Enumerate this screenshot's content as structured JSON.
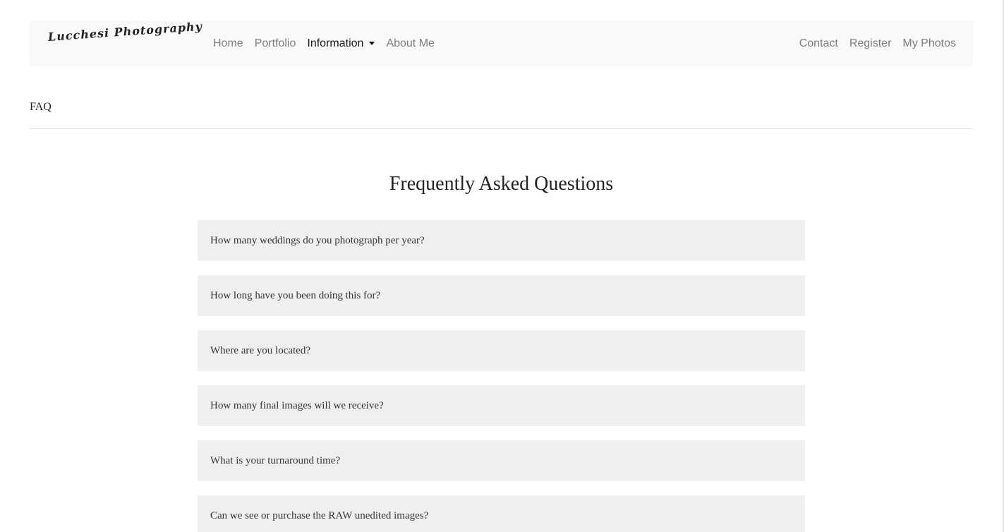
{
  "brand": {
    "logo_text": "Lucchesi Photography"
  },
  "nav": {
    "left_items": [
      {
        "label": "Home",
        "active": false
      },
      {
        "label": "Portfolio",
        "active": false
      },
      {
        "label": "Information",
        "active": true,
        "dropdown": true
      },
      {
        "label": "About Me",
        "active": false
      }
    ],
    "right_items": [
      {
        "label": "Contact"
      },
      {
        "label": "Register"
      },
      {
        "label": "My Photos"
      }
    ]
  },
  "breadcrumb": {
    "current": "FAQ"
  },
  "main": {
    "title": "Frequently Asked Questions",
    "questions": [
      "How many weddings do you photograph per year?",
      "How long have you been doing this for?",
      "Where are you located?",
      "How many final images will we receive?",
      "What is your turnaround time?",
      "Can we see or purchase the RAW unedited images?"
    ]
  },
  "colors": {
    "navbar_bg": "#f8f9fa",
    "faq_item_bg": "#efefef",
    "nav_link": "rgba(0,0,0,0.5)",
    "nav_link_active": "rgba(0,0,0,0.9)"
  },
  "icons": {
    "dropdown": "caret-down-icon"
  }
}
